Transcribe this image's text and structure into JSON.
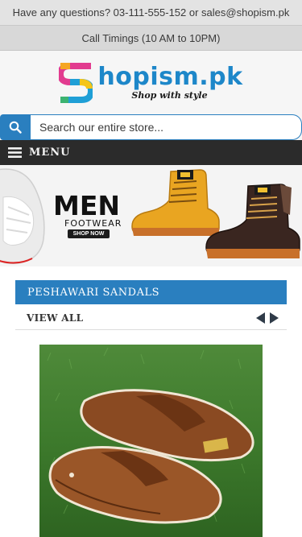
{
  "topbar": {
    "contact_text": "Have any questions? 03-111-555-152 or sales@shopism.pk"
  },
  "timings": {
    "text": "Call Timings (10 AM to 10PM)"
  },
  "logo": {
    "word": "hopism.pk",
    "tagline": "Shop with style",
    "icon": "shopism-s-logo"
  },
  "search": {
    "placeholder": "Search our entire store...",
    "icon": "search-icon",
    "button_color": "#2a7fbf"
  },
  "menu": {
    "label": "MENU",
    "icon": "hamburger-icon"
  },
  "banner": {
    "title": "MEN",
    "subtitle": "FOOTWEAR",
    "cta": "SHOP NOW",
    "images": [
      "white-sneaker",
      "yellow-work-boot",
      "dark-brown-work-boot"
    ]
  },
  "section": {
    "title": "PESHAWARI SANDALS",
    "view_all": "VIEW ALL",
    "prev_icon": "arrow-left-icon",
    "next_icon": "arrow-right-icon"
  },
  "product": {
    "image": "peshawari-sandals-on-grass"
  },
  "colors": {
    "brand_blue": "#2a7fbf",
    "menu_bg": "#2b2b2b",
    "logo_blue": "#1d87c9"
  }
}
